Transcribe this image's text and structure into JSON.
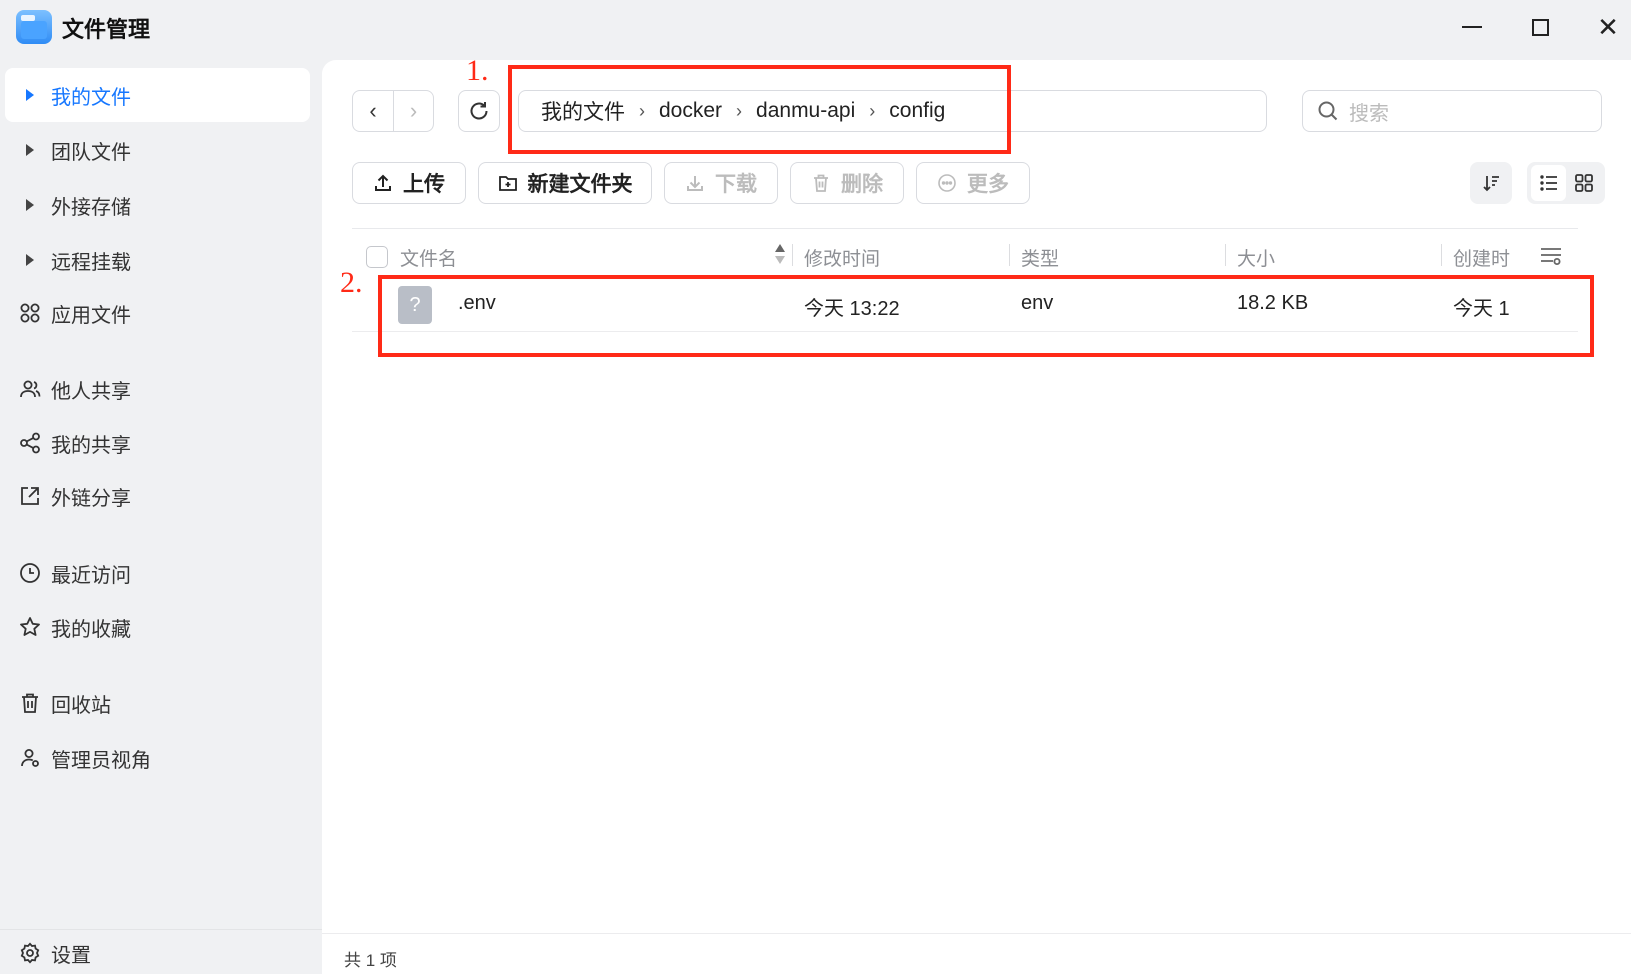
{
  "window": {
    "title": "文件管理",
    "minimize_icon": "minimize-icon",
    "maximize_icon": "maximize-icon",
    "close_glyph": "✕"
  },
  "sidebar": {
    "items": [
      {
        "label": "我的文件",
        "icon": "caret-right-icon",
        "active": true
      },
      {
        "label": "团队文件",
        "icon": "caret-right-icon"
      },
      {
        "label": "外接存储",
        "icon": "caret-right-icon"
      },
      {
        "label": "远程挂载",
        "icon": "caret-right-icon"
      },
      {
        "label": "应用文件",
        "icon": "grid-apps-icon"
      },
      {
        "label": "他人共享",
        "icon": "users-icon"
      },
      {
        "label": "我的共享",
        "icon": "share-icon"
      },
      {
        "label": "外链分享",
        "icon": "external-link-icon"
      },
      {
        "label": "最近访问",
        "icon": "clock-icon"
      },
      {
        "label": "我的收藏",
        "icon": "star-icon"
      },
      {
        "label": "回收站",
        "icon": "trash-icon"
      },
      {
        "label": "管理员视角",
        "icon": "admin-user-icon"
      }
    ],
    "settings_label": "设置"
  },
  "toolbar": {
    "back_glyph": "‹",
    "forward_glyph": "›",
    "breadcrumb": [
      "我的文件",
      "docker",
      "danmu-api",
      "config"
    ],
    "breadcrumb_sep": "›",
    "search_placeholder": "搜索",
    "upload_label": "上传",
    "new_folder_label": "新建文件夹",
    "download_label": "下载",
    "delete_label": "删除",
    "more_label": "更多"
  },
  "table": {
    "columns": [
      "文件名",
      "修改时间",
      "类型",
      "大小",
      "创建时"
    ],
    "rows": [
      {
        "name": ".env",
        "modified": "今天 13:22",
        "type": "env",
        "size": "18.2 KB",
        "created": "今天 1",
        "icon_glyph": "?"
      }
    ]
  },
  "annotations": [
    "1.",
    "2."
  ],
  "footer": {
    "count_text": "共 1 项"
  },
  "colors": {
    "accent": "#1677ff",
    "annotation": "#ff2a17",
    "sidebar_bg": "#f0f1f3"
  }
}
